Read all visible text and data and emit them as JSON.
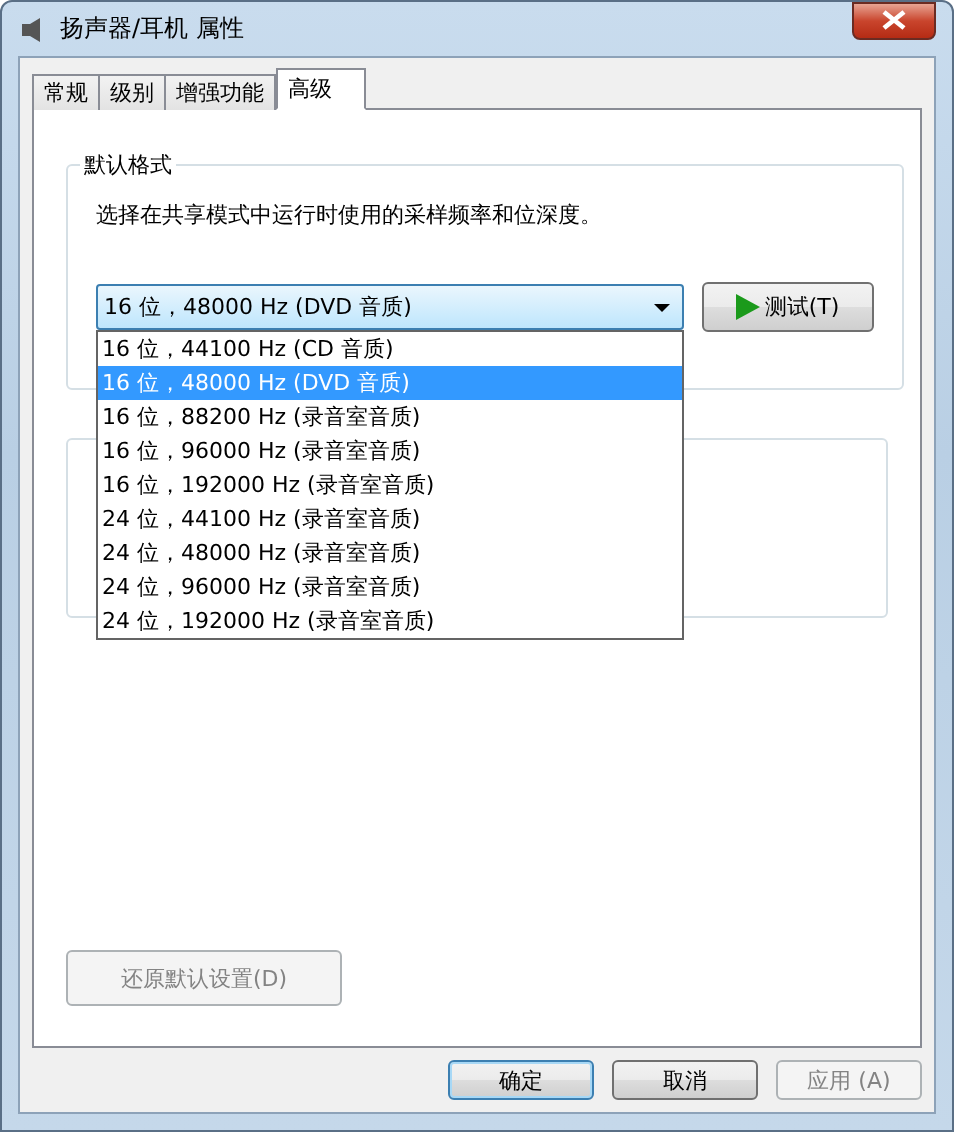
{
  "window": {
    "title": "扬声器/耳机 属性"
  },
  "tabs": [
    {
      "label": "常规",
      "selected": false
    },
    {
      "label": "级别",
      "selected": false
    },
    {
      "label": "增强功能",
      "selected": false
    },
    {
      "label": "高级",
      "selected": true
    }
  ],
  "default_format": {
    "title": "默认格式",
    "description": "选择在共享模式中运行时使用的采样频率和位深度。",
    "combo": {
      "value": "16 位，48000 Hz (DVD 音质)",
      "expanded": true
    },
    "test_button": {
      "label": "测试(T)",
      "disabled": false
    },
    "options": [
      {
        "label": "16 位，44100 Hz (CD 音质)",
        "selected": false
      },
      {
        "label": "16 位，48000 Hz (DVD 音质)",
        "selected": true
      },
      {
        "label": "16 位，88200 Hz (录音室音质)",
        "selected": false
      },
      {
        "label": "16 位，96000 Hz (录音室音质)",
        "selected": false
      },
      {
        "label": "16 位，192000 Hz (录音室音质)",
        "selected": false
      },
      {
        "label": "24 位，44100 Hz (录音室音质)",
        "selected": false
      },
      {
        "label": "24 位，48000 Hz (录音室音质)",
        "selected": false
      },
      {
        "label": "24 位，96000 Hz (录音室音质)",
        "selected": false
      },
      {
        "label": "24 位，192000 Hz (录音室音质)",
        "selected": false
      }
    ]
  },
  "restore_button": {
    "label": "还原默认设置(D)",
    "disabled": true
  },
  "buttons": [
    {
      "label": "确定",
      "kind": "default",
      "disabled": false
    },
    {
      "label": "取消",
      "kind": "normal",
      "disabled": false
    },
    {
      "label": "应用 (A)",
      "kind": "normal",
      "disabled": true
    }
  ]
}
